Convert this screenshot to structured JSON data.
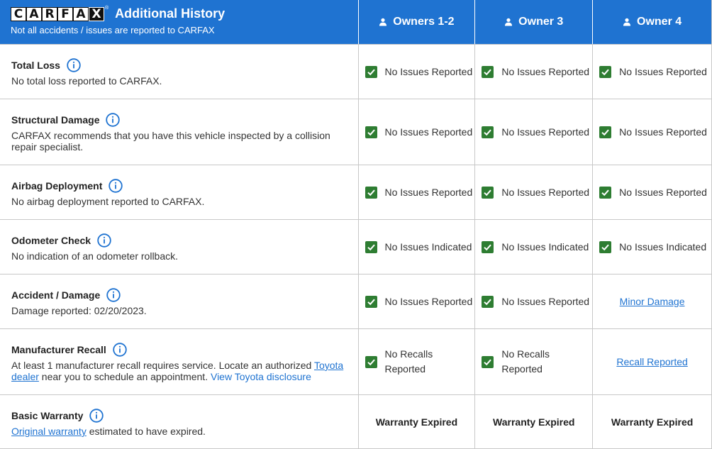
{
  "header": {
    "logo_letters": [
      "C",
      "A",
      "R",
      "F",
      "A",
      "X"
    ],
    "logo_trademark": "®",
    "title": "Additional History",
    "subtitle": "Not all accidents / issues are reported to CARFAX",
    "columns": [
      "Owners 1-2",
      "Owner 3",
      "Owner 4"
    ],
    "accent": "#1f73d1"
  },
  "rows": [
    {
      "title": "Total Loss",
      "desc": "No total loss reported to CARFAX.",
      "cells": [
        "No Issues Reported",
        "No Issues Reported",
        "No Issues Reported"
      ]
    },
    {
      "title": "Structural Damage",
      "desc": "CARFAX recommends that you have this vehicle inspected by a collision repair specialist.",
      "cells": [
        "No Issues Reported",
        "No Issues Reported",
        "No Issues Reported"
      ]
    },
    {
      "title": "Airbag Deployment",
      "desc": "No airbag deployment reported to CARFAX.",
      "cells": [
        "No Issues Reported",
        "No Issues Reported",
        "No Issues Reported"
      ]
    },
    {
      "title": "Odometer Check",
      "desc": "No indication of an odometer rollback.",
      "cells": [
        "No Issues Indicated",
        "No Issues Indicated",
        "No Issues Indicated"
      ]
    },
    {
      "title": "Accident / Damage",
      "desc": "Damage reported: 02/20/2023.",
      "cells": [
        "No Issues Reported",
        "No Issues Reported",
        "Minor Damage"
      ]
    },
    {
      "title": "Manufacturer Recall",
      "desc_part1": "At least 1 manufacturer recall requires service. Locate an authorized ",
      "desc_link1": "Toyota dealer",
      "desc_part2": " near you to schedule an appointment. ",
      "desc_link2": "View Toyota disclosure",
      "cells": [
        "No Recalls Reported",
        "No Recalls Reported",
        "Recall Reported"
      ]
    },
    {
      "title": "Basic Warranty",
      "desc_link": "Original warranty",
      "desc_rest": " estimated to have expired.",
      "cells": [
        "Warranty Expired",
        "Warranty Expired",
        "Warranty Expired"
      ]
    }
  ],
  "colors": {
    "check_green": "#2e7d32",
    "link_blue": "#1f73d1"
  },
  "icons": {
    "info": "info-circle-icon",
    "person": "person-icon",
    "check": "checkbox-checked-icon"
  }
}
